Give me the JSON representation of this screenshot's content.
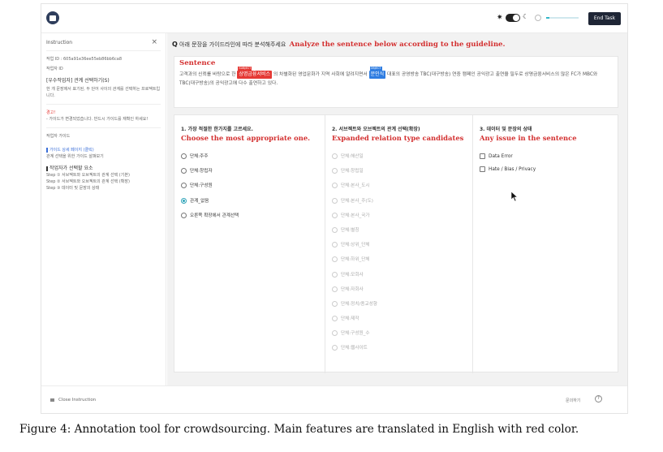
{
  "topbar": {
    "end_task_label": "End Task",
    "progress": 0.1
  },
  "sidebar": {
    "title": "Instruction",
    "close_glyph": "×",
    "task_id_label": "작업 ID : 605a91e36ee55eb86bb6ca8",
    "worker_id_label": "작업자 ID",
    "task_title": "[우수작업자] 관계 선택하기(S)",
    "task_desc": "한 개 문장에서 표기된, 두 단어 사이의 관계를 선택하는 프로젝트입니다.",
    "warning_title": "경고!",
    "warning_text": "- 가이드가 변경되었습니다. 반드시 가이드를 재확인 하세요!",
    "guide_title": "작업자 가이드",
    "guide_link": "가이드 상세 페이지 (클릭)",
    "guide_link_desc": "관계 선택을 위한 가이드 살펴보기",
    "steps_title": "작업자가 선택할 요소",
    "steps": [
      "Step ① 서브젝트와 오브젝트의 관계 선택 (기본)",
      "Step ② 서브젝트와 오브젝트의 관계 선택 (확장)",
      "Step ③ 데이터 및 문장의 상태"
    ]
  },
  "main": {
    "question_prefix": "Q",
    "question_ko": "아래 문장을 가이드라인에 따라 분석해주세요",
    "question_en": "Analyze the sentence below according to the guideline.",
    "sentence": {
      "title": "Sentence",
      "part1": "고객과의 신뢰를 바탕으로 한 ",
      "subject_label": "SUBJECT",
      "subject": "상명금융서비스",
      "part2": " 의 차별화된 영업문화가 지역 사회에 알려지면서 ",
      "object_label": "OBJECT",
      "object": "문인식",
      "part3": " 대표의 공영방송 TBC(대구방송) 연중 캠페인 공익광고 출연을 필두로 상명금융서비스의 많은 FC가 MBC와 TBC(대구방송)의 공익광고에 다수 출연하고 있다."
    },
    "col1": {
      "title_ko": "1. 가장 적절한 한가지를 고르세요.",
      "title_en": "Choose the most appropriate one.",
      "options": [
        "단체:주주",
        "단체:창립자",
        "단체:구성원",
        "관계_없음",
        "오른쪽 확장에서 관계선택"
      ],
      "selected": "관계_없음"
    },
    "col2": {
      "title_ko": "2. 서브젝트와 오브젝트의 관계 선택(확장)",
      "title_en": "Expanded relation type candidates",
      "options": [
        "단체:해산일",
        "단체:창립일",
        "단체:본사_도시",
        "단체:본사_주(도)",
        "단체:본사_국가",
        "단체:별칭",
        "단체:상위_단체",
        "단체:하위_단체",
        "단체:모회사",
        "단체:자회사",
        "단체:정치/종교성향",
        "단체:제작",
        "단체:구성원_수",
        "단체:웹사이트"
      ]
    },
    "col3": {
      "title_ko": "3. 데이터 및 문장의 상태",
      "title_en": "Any issue in the sentence",
      "options": [
        "Data Error",
        "Hate / Bias / Privacy"
      ]
    }
  },
  "bottombar": {
    "close_instruction": "Close Instruction",
    "help_label": "문의하기",
    "help_glyph": "?"
  },
  "caption": "Figure 4: Annotation tool for crowdsourcing. Main features are translated in English with red color."
}
